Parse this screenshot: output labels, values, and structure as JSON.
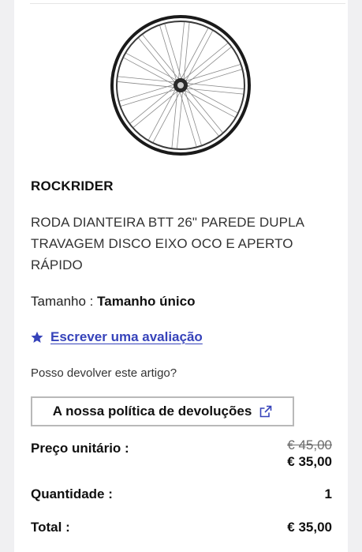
{
  "product": {
    "brand": "ROCKRIDER",
    "title": "RODA DIANTEIRA BTT 26\" PAREDE DUPLA TRAVAGEM DISCO EIXO OCO E APERTO RÁPIDO",
    "image_icon": "bicycle-wheel-image",
    "size_label": "Tamanho :",
    "size_value": "Tamanho único"
  },
  "review": {
    "icon": "star-icon",
    "link_label": "Escrever uma avaliação"
  },
  "returns": {
    "question": "Posso devolver este artigo?",
    "policy_button_label": "A nossa política de devoluções",
    "policy_icon": "external-link-icon"
  },
  "pricing": {
    "unit_price_label": "Preço unitário :",
    "old_price": "€ 45,00",
    "new_price": "€ 35,00",
    "quantity_label": "Quantidade :",
    "quantity_value": "1",
    "total_label": "Total :",
    "total_value": "€ 35,00"
  },
  "colors": {
    "accent": "#3643ba",
    "text": "#101010",
    "border": "#b9b9b9"
  }
}
